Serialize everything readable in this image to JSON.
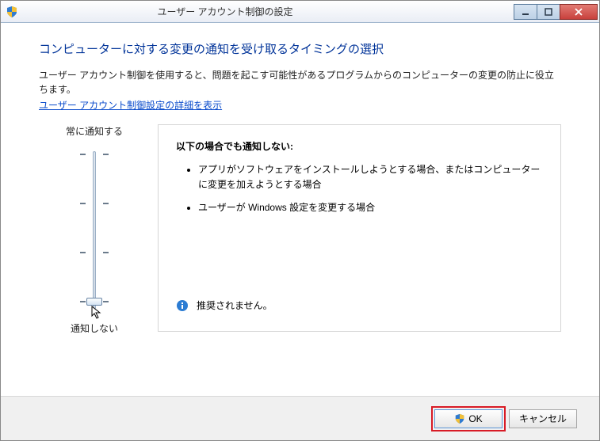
{
  "window": {
    "title": "ユーザー アカウント制御の設定"
  },
  "page": {
    "heading": "コンピューターに対する変更の通知を受け取るタイミングの選択",
    "description": "ユーザー アカウント制御を使用すると、問題を起こす可能性があるプログラムからのコンピューターの変更の防止に役立ちます。",
    "link": "ユーザー アカウント制御設定の詳細を表示"
  },
  "slider": {
    "top_label": "常に通知する",
    "bottom_label": "通知しない",
    "levels": 4,
    "current_level": 0
  },
  "panel": {
    "title": "以下の場合でも通知しない:",
    "bullets": [
      "アプリがソフトウェアをインストールしようとする場合、またはコンピューターに変更を加えようとする場合",
      "ユーザーが Windows 設定を変更する場合"
    ],
    "recommendation": "推奨されません。"
  },
  "footer": {
    "ok": "OK",
    "cancel": "キャンセル"
  }
}
